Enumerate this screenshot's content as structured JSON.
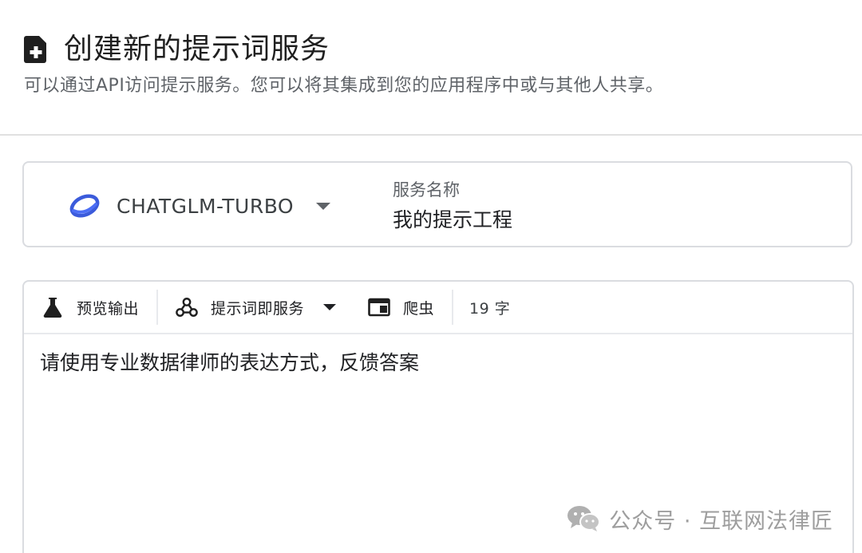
{
  "header": {
    "title": "创建新的提示词服务",
    "subtitle": "可以通过API访问提示服务。您可以将其集成到您的应用程序中或与其他人共享。",
    "icon": "file-add-icon"
  },
  "service": {
    "model_name": "CHATGLM-TURBO",
    "model_icon": "zhipu-logo",
    "name_label": "服务名称",
    "name_value": "我的提示工程"
  },
  "toolbar": {
    "preview_label": "预览输出",
    "preview_icon": "flask-icon",
    "mode_label": "提示词即服务",
    "mode_icon": "webhook-icon",
    "crawler_label": "爬虫",
    "crawler_icon": "web-window-icon",
    "char_count": "19 字"
  },
  "editor": {
    "prompt_text": "请使用专业数据律师的表达方式，反馈答案"
  },
  "watermark": {
    "text": "公众号 · 互联网法律匠",
    "icon": "wechat-icon"
  },
  "colors": {
    "accent_blue": "#3b5bdb",
    "border": "#dadce0",
    "muted_text": "#5f6368"
  }
}
